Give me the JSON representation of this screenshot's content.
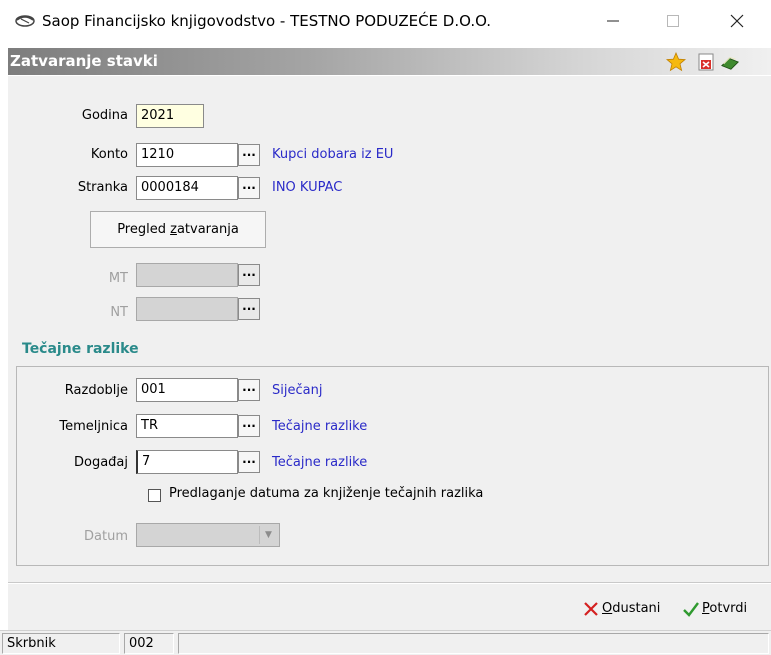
{
  "window": {
    "title": "Saop Financijsko knjigovodstvo - TESTNO PODUZEĆE D.O.O.",
    "icons": [
      "app-icon",
      "minimize-icon",
      "maximize-icon",
      "close-icon"
    ]
  },
  "form": {
    "title": "Zatvaranje stavki",
    "toolbar_icons": [
      "favorite-star-icon",
      "excel-export-icon",
      "help-book-icon"
    ]
  },
  "fields": {
    "godina": {
      "label": "Godina",
      "value": "2021"
    },
    "konto": {
      "label": "Konto",
      "value": "1210",
      "description": "Kupci dobara iz EU"
    },
    "stranka": {
      "label": "Stranka",
      "value": "0000184",
      "description": "INO KUPAC"
    },
    "mt": {
      "label": "MT",
      "value": ""
    },
    "nt": {
      "label": "NT",
      "value": ""
    }
  },
  "preview_button": {
    "label_pre": "Pregled ",
    "label_ul": "z",
    "label_post": "atvaranja"
  },
  "exchange_diff": {
    "section_title": "Tečajne razlike",
    "razdoblje": {
      "label": "Razdoblje",
      "value": "001",
      "description": "Siječanj"
    },
    "temeljnica": {
      "label": "Temeljnica",
      "value": "TR",
      "description": "Tečajne razlike"
    },
    "dogadjaj": {
      "label": "Događaj",
      "value": "7",
      "description": "Tečajne razlike"
    },
    "checkbox": {
      "label": "Predlaganje datuma za knjiženje tečajnih razlika",
      "checked": false
    },
    "datum": {
      "label": "Datum",
      "value": ""
    }
  },
  "browse_button_glyph": "...",
  "actions": {
    "cancel": {
      "ul": "O",
      "rest": "dustani"
    },
    "confirm": {
      "ul": "P",
      "rest": "otvrdi"
    }
  },
  "status": {
    "label": "Skrbnik",
    "value": "002",
    "extra": ""
  },
  "colors": {
    "description_text": "#2a2ac8",
    "section_title": "#2a8a8a",
    "year_field_bg": "#ffffe1",
    "panel_bg": "#f0f0f0"
  }
}
